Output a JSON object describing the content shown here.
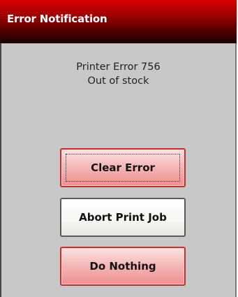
{
  "window": {
    "title": "Error Notification"
  },
  "message": {
    "line1": "Printer Error 756",
    "line2": "Out of stock"
  },
  "buttons": {
    "clear_error": "Clear Error",
    "abort_print_job": "Abort Print Job",
    "do_nothing": "Do Nothing"
  },
  "colors": {
    "titlebar_top": "#d60000",
    "titlebar_bottom": "#1a0000",
    "dialog_background": "#c8c8c8",
    "danger_button_border": "#c23030",
    "danger_button_fill": "#f6b9b9"
  }
}
